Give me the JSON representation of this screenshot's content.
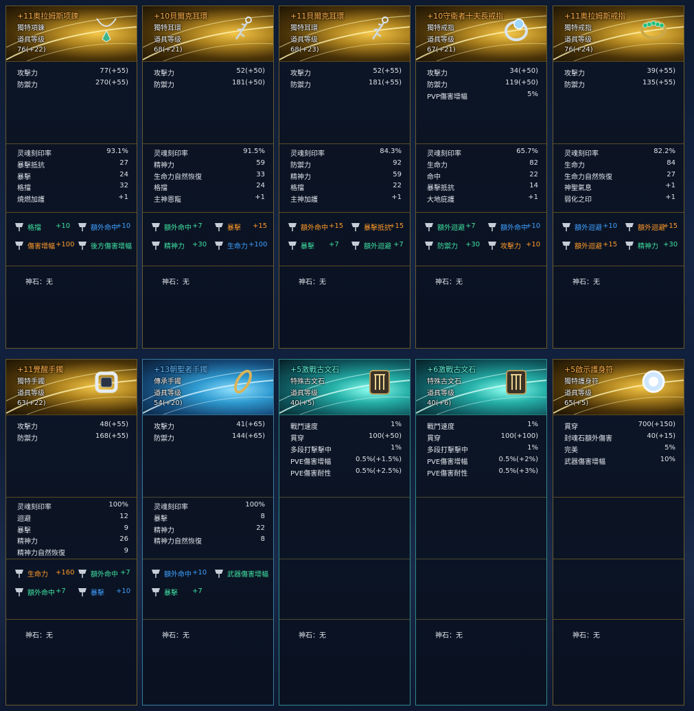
{
  "rune_label": "神石：无",
  "cards": [
    {
      "theme": "gold",
      "title": "+11奥拉姆斯项鍊",
      "title_color": "#ffb04a",
      "type": "獨特項鍊",
      "level_label": "道具等级",
      "level": "76(+22)",
      "icon": "necklace-icon",
      "base": [
        [
          "攻擊力",
          "77(+55)"
        ],
        [
          "防禦力",
          "270(+55)"
        ]
      ],
      "stats": [
        [
          "灵魂刻印率",
          "93.1%"
        ],
        [
          "暴擊抵抗",
          "27"
        ],
        [
          "暴擊",
          "24"
        ],
        [
          "格擋",
          "32"
        ],
        [
          "燒燃加護",
          "+1"
        ]
      ],
      "opts": [
        {
          "name": "格擋",
          "val": "+10",
          "color": "green"
        },
        {
          "name": "額外命中",
          "val": "+10",
          "color": "blue"
        },
        {
          "name": "傷害增幅",
          "val": "+100",
          "color": "orange"
        },
        {
          "name": "後方傷害增幅",
          "val": "",
          "color": "green"
        }
      ]
    },
    {
      "theme": "gold",
      "title": "+10貝爾克耳環",
      "title_color": "#ffb04a",
      "type": "獨特耳環",
      "level_label": "道具等级",
      "level": "68(+21)",
      "icon": "earring-icon",
      "base": [
        [
          "攻擊力",
          "52(+50)"
        ],
        [
          "防禦力",
          "181(+50)"
        ]
      ],
      "stats": [
        [
          "灵魂刻印率",
          "91.5%"
        ],
        [
          "精神力",
          "59"
        ],
        [
          "生命力自然恢復",
          "33"
        ],
        [
          "格擋",
          "24"
        ],
        [
          "主神恩寵",
          "+1"
        ]
      ],
      "opts": [
        {
          "name": "額外命中",
          "val": "+7",
          "color": "green"
        },
        {
          "name": "暴擊",
          "val": "+15",
          "color": "orange"
        },
        {
          "name": "精神力",
          "val": "+30",
          "color": "green"
        },
        {
          "name": "生命力",
          "val": "+100",
          "color": "blue"
        }
      ]
    },
    {
      "theme": "gold",
      "title": "+11貝爾克耳環",
      "title_color": "#ffb04a",
      "type": "獨特耳環",
      "level_label": "道具等级",
      "level": "68(+23)",
      "icon": "earring-icon",
      "base": [
        [
          "攻擊力",
          "52(+55)"
        ],
        [
          "防禦力",
          "181(+55)"
        ]
      ],
      "stats": [
        [
          "灵魂刻印率",
          "84.3%"
        ],
        [
          "防禦力",
          "92"
        ],
        [
          "精神力",
          "59"
        ],
        [
          "格擋",
          "22"
        ],
        [
          "主神加護",
          "+1"
        ]
      ],
      "opts": [
        {
          "name": "額外命中",
          "val": "+15",
          "color": "orange"
        },
        {
          "name": "暴擊抵抗",
          "val": "+15",
          "color": "orange"
        },
        {
          "name": "暴擊",
          "val": "+7",
          "color": "green"
        },
        {
          "name": "額外迴避",
          "val": "+7",
          "color": "green"
        }
      ]
    },
    {
      "theme": "gold",
      "title": "+10守衛者十夫長戒指",
      "title_color": "#ffb04a",
      "type": "獨特戒指",
      "level_label": "道具等级",
      "level": "67(+21)",
      "icon": "ring-icon",
      "base": [
        [
          "攻擊力",
          "34(+50)"
        ],
        [
          "防禦力",
          "119(+50)"
        ],
        [
          "PVP傷害增幅",
          "5%"
        ]
      ],
      "stats": [
        [
          "灵魂刻印率",
          "65.7%"
        ],
        [
          "生命力",
          "82"
        ],
        [
          "命中",
          "22"
        ],
        [
          "暴擊抵抗",
          "14"
        ],
        [
          "大地庇護",
          "+1"
        ]
      ],
      "opts": [
        {
          "name": "額外迴避",
          "val": "+7",
          "color": "green"
        },
        {
          "name": "額外命中",
          "val": "+10",
          "color": "blue"
        },
        {
          "name": "防禦力",
          "val": "+30",
          "color": "green"
        },
        {
          "name": "攻擊力",
          "val": "+10",
          "color": "orange"
        }
      ]
    },
    {
      "theme": "gold",
      "title": "+11奥拉姆斯戒指",
      "title_color": "#ffb04a",
      "type": "獨特戒指",
      "level_label": "道具等级",
      "level": "76(+24)",
      "icon": "emerald-ring-icon",
      "base": [
        [
          "攻擊力",
          "39(+55)"
        ],
        [
          "防禦力",
          "135(+55)"
        ]
      ],
      "stats": [
        [
          "灵魂刻印率",
          "82.2%"
        ],
        [
          "生命力",
          "84"
        ],
        [
          "生命力自然恢復",
          "27"
        ],
        [
          "神聖氣息",
          "+1"
        ],
        [
          "弱化之印",
          "+1"
        ]
      ],
      "opts": [
        {
          "name": "額外迴避",
          "val": "+10",
          "color": "blue"
        },
        {
          "name": "額外迴避",
          "val": "+15",
          "color": "orange"
        },
        {
          "name": "額外迴避",
          "val": "+15",
          "color": "orange"
        },
        {
          "name": "精神力",
          "val": "+30",
          "color": "green"
        }
      ]
    },
    {
      "theme": "gold",
      "title": "+11覺醒手鐲",
      "title_color": "#ffb04a",
      "type": "獨特手鐲",
      "level_label": "道具等级",
      "level": "63(+22)",
      "icon": "bracelet-icon",
      "base": [
        [
          "攻擊力",
          "48(+55)"
        ],
        [
          "防禦力",
          "168(+55)"
        ]
      ],
      "stats": [
        [
          "灵魂刻印率",
          "100%"
        ],
        [
          "迴避",
          "12"
        ],
        [
          "暴擊",
          "9"
        ],
        [
          "精神力",
          "26"
        ],
        [
          "精神力自然恢復",
          "9"
        ]
      ],
      "opts": [
        {
          "name": "生命力",
          "val": "+160",
          "color": "orange"
        },
        {
          "name": "額外命中",
          "val": "+7",
          "color": "green"
        },
        {
          "name": "額外命中",
          "val": "+7",
          "color": "green"
        },
        {
          "name": "暴擊",
          "val": "+10",
          "color": "blue"
        }
      ]
    },
    {
      "theme": "blue",
      "title": "+13朝聖者手鐲",
      "title_color": "#5ab8ff",
      "type": "傳承手鐲",
      "level_label": "道具等级",
      "level": "54(+20)",
      "icon": "bangle-icon",
      "base": [
        [
          "攻擊力",
          "41(+65)"
        ],
        [
          "防禦力",
          "144(+65)"
        ]
      ],
      "stats": [
        [
          "灵魂刻印率",
          "100%"
        ],
        [
          "暴擊",
          "8"
        ],
        [
          "精神力",
          "22"
        ],
        [
          "精神力自然恢復",
          "8"
        ]
      ],
      "opts": [
        {
          "name": "額外命中",
          "val": "+10",
          "color": "blue"
        },
        {
          "name": "武器傷害增幅",
          "val": "",
          "color": "green"
        },
        {
          "name": "暴擊",
          "val": "+7",
          "color": "green"
        }
      ]
    },
    {
      "theme": "teal",
      "title": "+5激戰古文石",
      "title_color": "#5ff0d8",
      "type": "特殊古文石",
      "level_label": "道具等级",
      "level": "40(+5)",
      "icon": "rune-stone-icon",
      "base": [
        [
          "戰鬥速度",
          "1%"
        ],
        [
          "貫穿",
          "100(+50)"
        ],
        [
          "多段打擊擊中",
          "1%"
        ],
        [
          "PVE傷害增幅",
          "0.5%(+1.5%)"
        ],
        [
          "PVE傷害耐性",
          "0.5%(+2.5%)"
        ]
      ],
      "stats": [],
      "opts": []
    },
    {
      "theme": "teal",
      "title": "+6激戰古文石",
      "title_color": "#5ff0d8",
      "type": "特殊古文石",
      "level_label": "道具等级",
      "level": "40(+6)",
      "icon": "rune-stone-icon",
      "base": [
        [
          "戰鬥速度",
          "1%"
        ],
        [
          "貫穿",
          "100(+100)"
        ],
        [
          "多段打擊擊中",
          "1%"
        ],
        [
          "PVE傷害增幅",
          "0.5%(+2%)"
        ],
        [
          "PVE傷害耐性",
          "0.5%(+3%)"
        ]
      ],
      "stats": [],
      "opts": []
    },
    {
      "theme": "gold",
      "title": "+5啟示護身符",
      "title_color": "#ffb04a",
      "type": "獨特護身符",
      "level_label": "道具等级",
      "level": "65(+5)",
      "icon": "amulet-icon",
      "base": [
        [
          "貫穿",
          "700(+150)"
        ],
        [
          "封魂石額外傷害",
          "40(+15)"
        ],
        [
          "完美",
          "5%"
        ],
        [
          "武器傷害增幅",
          "10%"
        ]
      ],
      "stats": [],
      "opts": []
    }
  ]
}
